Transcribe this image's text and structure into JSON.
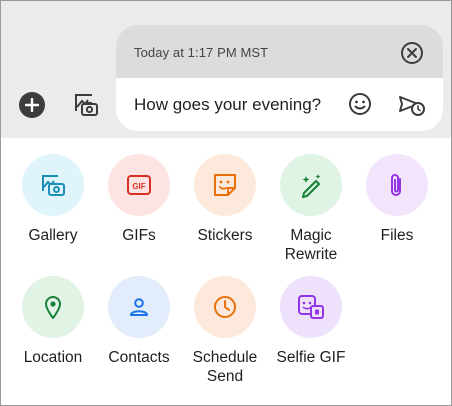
{
  "compose": {
    "timestamp": "Today at 1:17 PM MST",
    "message": "How goes your evening?"
  },
  "attachments": [
    {
      "label": "Gallery",
      "icon": "gallery-icon",
      "color": "#1a8fb8"
    },
    {
      "label": "GIFs",
      "icon": "gif-icon",
      "color": "#d93025"
    },
    {
      "label": "Stickers",
      "icon": "sticker-icon",
      "color": "#e8710a"
    },
    {
      "label": "Magic Rewrite",
      "icon": "magic-pen-icon",
      "color": "#188038"
    },
    {
      "label": "Files",
      "icon": "paperclip-icon",
      "color": "#9334e6"
    },
    {
      "label": "Location",
      "icon": "location-pin-icon",
      "color": "#188038"
    },
    {
      "label": "Contacts",
      "icon": "contact-icon",
      "color": "#1a73e8"
    },
    {
      "label": "Schedule Send",
      "icon": "clock-icon",
      "color": "#e8710a"
    },
    {
      "label": "Selfie GIF",
      "icon": "selfie-gif-icon",
      "color": "#9334e6"
    }
  ]
}
